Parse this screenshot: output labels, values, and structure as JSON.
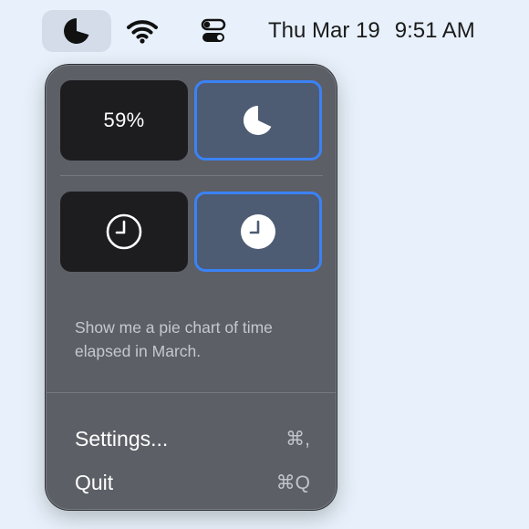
{
  "menubar": {
    "app_icon": "moon-pie-icon",
    "wifi_icon": "wifi-icon",
    "control_center_icon": "control-center-icon",
    "date": "Thu Mar 19",
    "time": "9:51 AM"
  },
  "popover": {
    "percent_label": "59%",
    "pie_icon": "pie-chart-icon",
    "clock_outline_icon": "clock-outline-icon",
    "clock_filled_icon": "clock-filled-icon",
    "description": "Show me a pie chart of time elapsed in March.",
    "menu": [
      {
        "label": "Settings...",
        "shortcut": "⌘,"
      },
      {
        "label": "Quit",
        "shortcut": "⌘Q"
      }
    ]
  },
  "colors": {
    "desktop": "#e8f1fb",
    "popover": "#5c5f66",
    "tile_dark": "#1d1d1f",
    "tile_selected": "#4d5b73",
    "accent": "#3b82f6"
  }
}
